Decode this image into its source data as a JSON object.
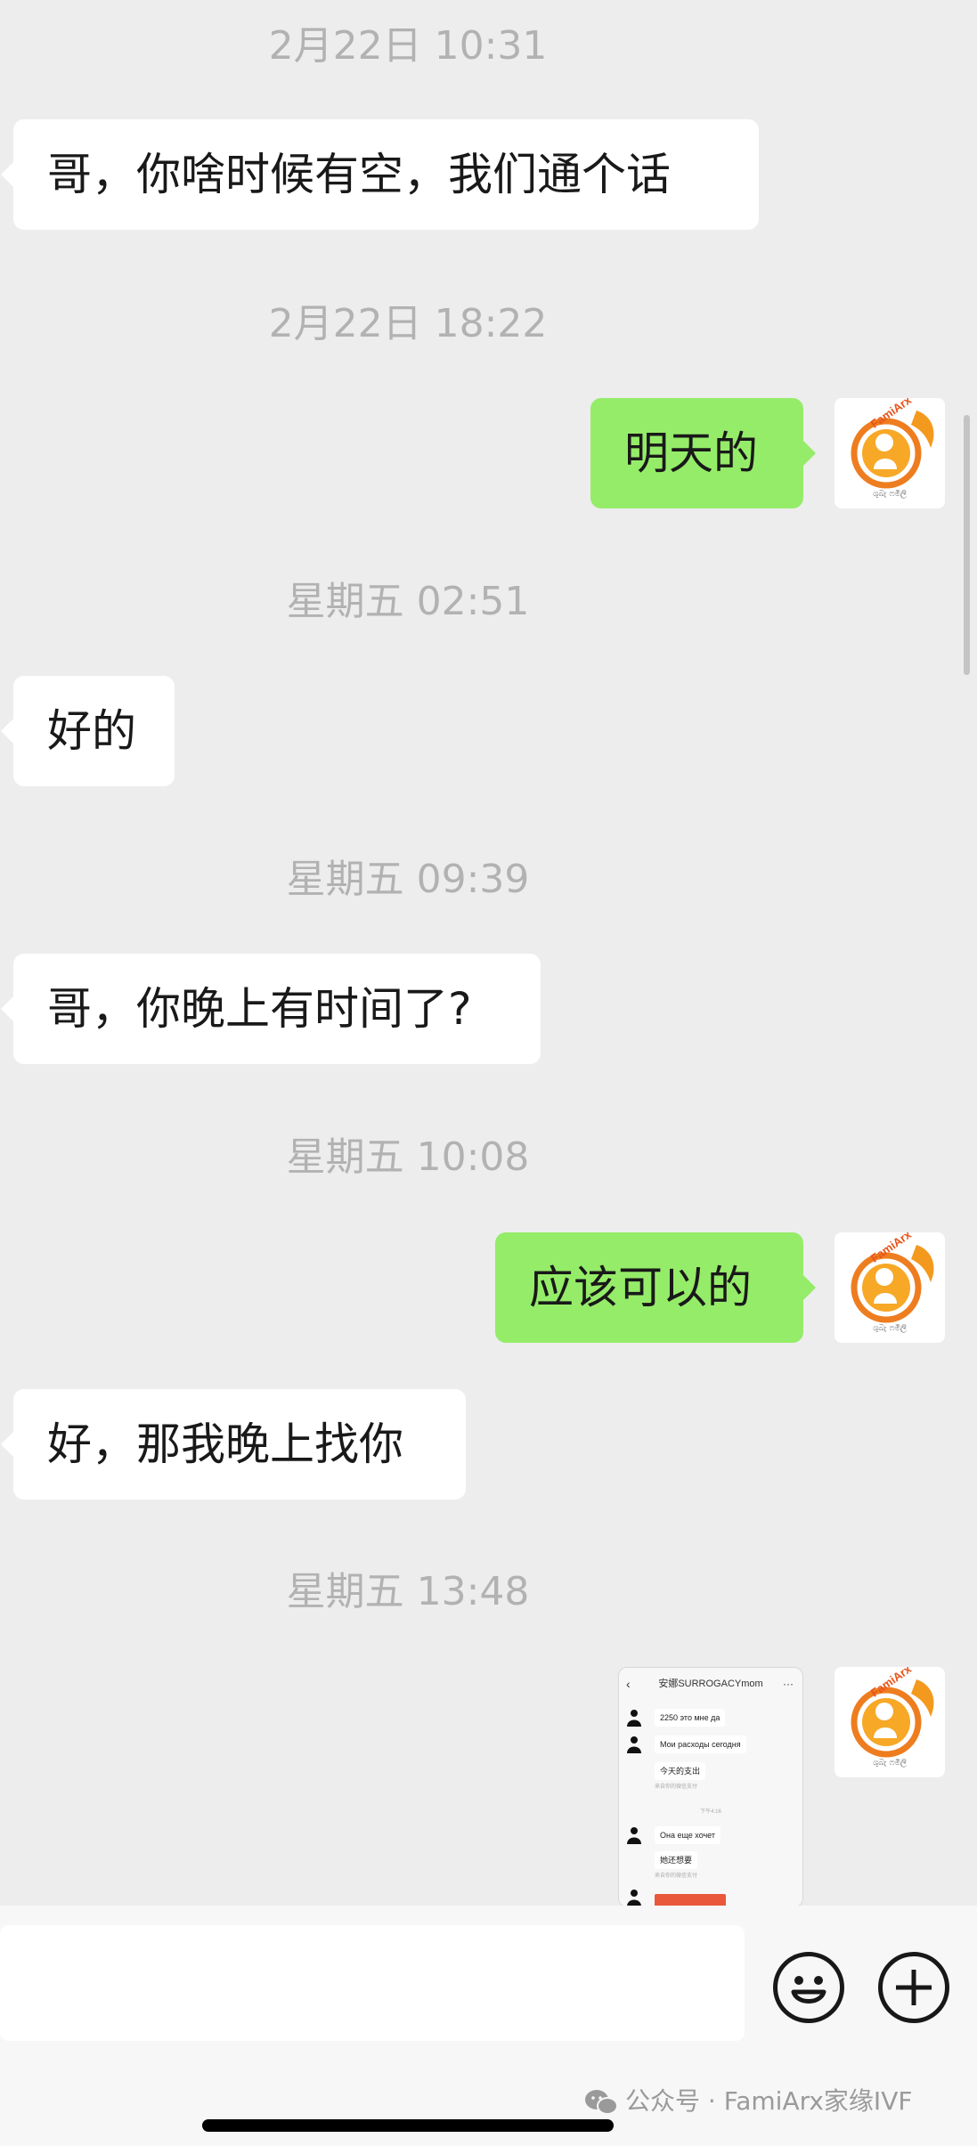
{
  "messages": [
    {
      "type": "timestamp",
      "text": "2月22日 10:31"
    },
    {
      "type": "incoming",
      "text": "哥，你啥时候有空，我们通个话"
    },
    {
      "type": "timestamp",
      "text": "2月22日 18:22"
    },
    {
      "type": "outgoing",
      "text": "明天的"
    },
    {
      "type": "timestamp",
      "text": "星期五 02:51"
    },
    {
      "type": "incoming",
      "text": "好的"
    },
    {
      "type": "timestamp",
      "text": "星期五 09:39"
    },
    {
      "type": "incoming",
      "text": "哥，你晚上有时间了?"
    },
    {
      "type": "timestamp",
      "text": "星期五 10:08"
    },
    {
      "type": "outgoing",
      "text": "应该可以的"
    },
    {
      "type": "incoming",
      "text": "好，那我晚上找你"
    },
    {
      "type": "timestamp",
      "text": "星期五 13:48"
    }
  ],
  "avatar": {
    "brand": "FamiArx",
    "subtitle": "ශුබ෭ ෆමිලි",
    "icon": "famiarx-logo-icon"
  },
  "image_message": {
    "header": "安娜SURROGACYmom",
    "lines": [
      {
        "text": "2250 это мне да"
      },
      {
        "text": "Мои расходы сегодня"
      },
      {
        "text": "今天的支出",
        "sub": "来自你的微信支付"
      },
      {
        "text": "Она еще хочет"
      },
      {
        "text": "她还想要",
        "sub": "来自你的微信支付"
      }
    ],
    "time": "下午4:16"
  },
  "input_bar": {
    "emoji_icon": "emoji-face-icon",
    "plus_icon": "plus-icon"
  },
  "watermark": "公众号 · FamiArx家缘IVF",
  "colors": {
    "background": "#ededed",
    "incoming_bubble": "#ffffff",
    "outgoing_bubble": "#95ec69",
    "timestamp_text": "#b2b2b2",
    "logo_orange": "#f39a1e"
  }
}
